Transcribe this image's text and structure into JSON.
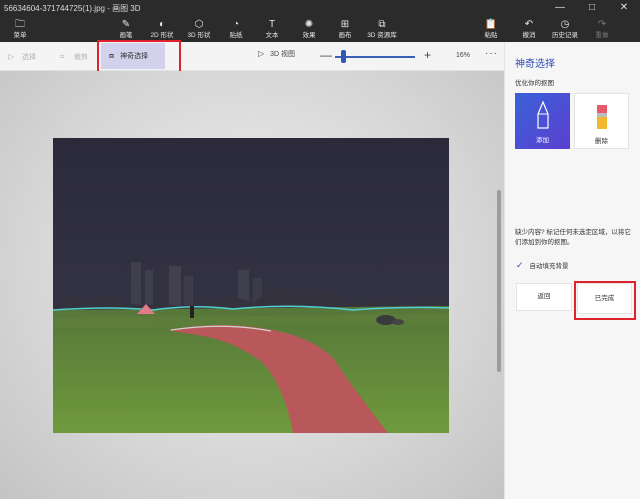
{
  "window": {
    "title": "56634604-371744725(1).jpg - 画图 3D",
    "controls": {
      "minimize": "—",
      "maximize": "□",
      "close": "✕"
    }
  },
  "ribbon": {
    "menu": {
      "label": "菜单",
      "icon": "folder-icon"
    },
    "tools": [
      {
        "label": "画笔",
        "icon": "brush-icon"
      },
      {
        "label": "2D 形状",
        "icon": "shapes-2d-icon"
      },
      {
        "label": "3D 形状",
        "icon": "cube-icon"
      },
      {
        "label": "贴纸",
        "icon": "sticker-icon"
      },
      {
        "label": "文本",
        "icon": "text-icon"
      },
      {
        "label": "效果",
        "icon": "effects-icon"
      },
      {
        "label": "画布",
        "icon": "canvas-icon"
      },
      {
        "label": "3D 资源库",
        "icon": "library-3d-icon"
      }
    ],
    "actions": [
      {
        "label": "粘贴",
        "icon": "paste-icon"
      },
      {
        "label": "撤消",
        "icon": "undo-icon"
      },
      {
        "label": "历史记录",
        "icon": "history-icon"
      },
      {
        "label": "重做",
        "icon": "redo-icon"
      }
    ]
  },
  "toolbar": {
    "select": "选择",
    "crop": "裁剪",
    "magic_select": "神奇选择",
    "view_3d": "3D 视图",
    "zoom": {
      "minus": "—",
      "plus": "+",
      "value": "16%",
      "level_fraction": 0.1
    },
    "more": "···"
  },
  "panel": {
    "title": "神奇选择",
    "subtitle": "优化你的抠图",
    "add_label": "添加",
    "remove_label": "删除",
    "hint": "缺少内容? 标记任何未选定区域，以将它们添加到你的抠图。",
    "autofill_label": "自动填充背景",
    "autofill_checked": true,
    "back_label": "返回",
    "done_label": "已完成"
  },
  "colors": {
    "accent": "#2f56b0",
    "ribbon_bg": "#2b2b2b",
    "annotation_red": "#e0212e",
    "add_card": "#4a55d6"
  }
}
